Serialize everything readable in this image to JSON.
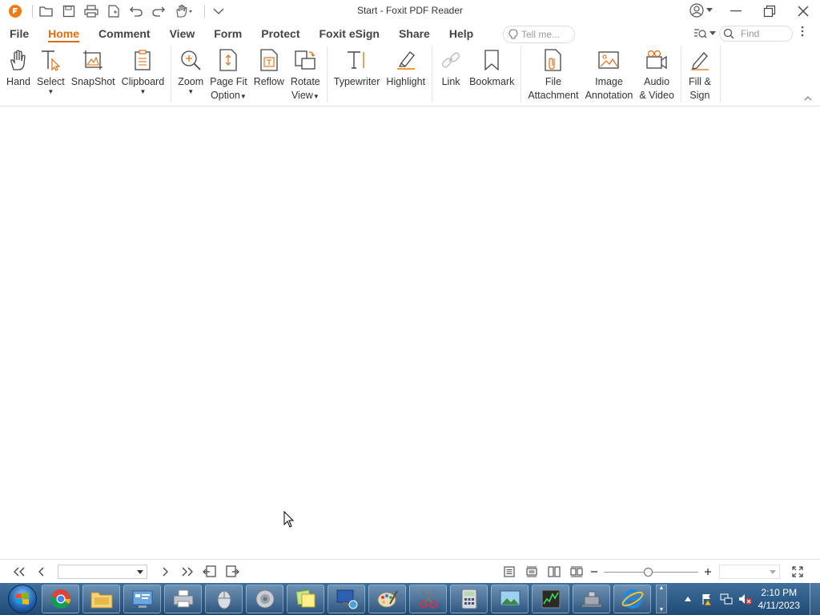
{
  "app": {
    "window_title": "Start - Foxit PDF Reader",
    "accent_color": "#e06c12"
  },
  "quick_access": {
    "icons": [
      "foxit-logo-icon",
      "open-folder-icon",
      "save-icon",
      "print-icon",
      "new-icon",
      "undo-icon",
      "redo-icon",
      "hand-tool-icon",
      "customize-icon"
    ]
  },
  "menu": {
    "tabs": [
      {
        "label": "File"
      },
      {
        "label": "Home",
        "active": true
      },
      {
        "label": "Comment"
      },
      {
        "label": "View"
      },
      {
        "label": "Form"
      },
      {
        "label": "Protect"
      },
      {
        "label": "Foxit eSign"
      },
      {
        "label": "Share"
      },
      {
        "label": "Help"
      }
    ],
    "tell_me_placeholder": "Tell me...",
    "find_placeholder": "Find"
  },
  "ribbon": {
    "hand": "Hand",
    "select": "Select",
    "snapshot": "SnapShot",
    "clipboard": "Clipboard",
    "zoom": "Zoom",
    "page_fit_1": "Page Fit",
    "page_fit_2": "Option",
    "reflow": "Reflow",
    "rotate_1": "Rotate",
    "rotate_2": "View",
    "typewriter": "Typewriter",
    "highlight": "Highlight",
    "link": "Link",
    "bookmark": "Bookmark",
    "file_att_1": "File",
    "file_att_2": "Attachment",
    "image_ann_1": "Image",
    "image_ann_2": "Annotation",
    "audio_1": "Audio",
    "audio_2": "& Video",
    "fill_1": "Fill &",
    "fill_2": "Sign"
  },
  "statusbar": {
    "page_value": "",
    "zoom_value": "",
    "zoom_level_fraction": 0.47
  },
  "taskbar": {
    "items": [
      "chrome-icon",
      "file-explorer-icon",
      "control-panel-icon",
      "printer-icon",
      "mouse-icon",
      "speaker-icon",
      "sticky-notes-icon",
      "remote-desktop-icon",
      "paint-icon",
      "snipping-tool-icon",
      "calculator-icon",
      "photo-viewer-icon",
      "task-manager-icon",
      "network-icon",
      "internet-explorer-icon"
    ],
    "time": "2:10 PM",
    "date": "4/11/2023"
  }
}
